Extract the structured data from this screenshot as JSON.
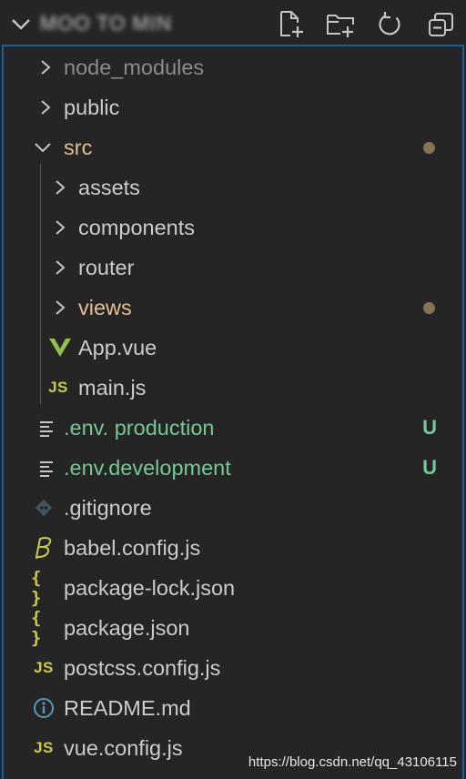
{
  "header": {
    "project_name": "MOO TO MIN",
    "actions": [
      "new-file-icon",
      "new-folder-icon",
      "refresh-icon",
      "collapse-all-icon"
    ]
  },
  "tree": {
    "items": [
      {
        "label": "node_modules",
        "kind": "folder",
        "expanded": false,
        "depth": 0,
        "status": "ignored"
      },
      {
        "label": "public",
        "kind": "folder",
        "expanded": false,
        "depth": 0
      },
      {
        "label": "src",
        "kind": "folder",
        "expanded": true,
        "depth": 0,
        "status": "modified"
      },
      {
        "label": "assets",
        "kind": "folder",
        "expanded": false,
        "depth": 1
      },
      {
        "label": "components",
        "kind": "folder",
        "expanded": false,
        "depth": 1
      },
      {
        "label": "router",
        "kind": "folder",
        "expanded": false,
        "depth": 1
      },
      {
        "label": "views",
        "kind": "folder",
        "expanded": false,
        "depth": 1,
        "status": "modified"
      },
      {
        "label": "App.vue",
        "kind": "file",
        "icon": "vue-icon",
        "depth": 1
      },
      {
        "label": "main.js",
        "kind": "file",
        "icon": "js-icon",
        "icon_text": "JS",
        "depth": 1
      },
      {
        "label": ".env. production",
        "kind": "file",
        "icon": "lines-icon",
        "depth": 0,
        "status": "untracked",
        "badge": "U"
      },
      {
        "label": ".env.development",
        "kind": "file",
        "icon": "lines-icon",
        "depth": 0,
        "status": "untracked",
        "badge": "U"
      },
      {
        "label": ".gitignore",
        "kind": "file",
        "icon": "git-icon",
        "depth": 0
      },
      {
        "label": "babel.config.js",
        "kind": "file",
        "icon": "babel-icon",
        "depth": 0
      },
      {
        "label": "package-lock.json",
        "kind": "file",
        "icon": "json-icon",
        "icon_text": "{ }",
        "depth": 0
      },
      {
        "label": "package.json",
        "kind": "file",
        "icon": "json-icon",
        "icon_text": "{ }",
        "depth": 0
      },
      {
        "label": "postcss.config.js",
        "kind": "file",
        "icon": "js-icon",
        "icon_text": "JS",
        "depth": 0
      },
      {
        "label": "README.md",
        "kind": "file",
        "icon": "info-icon",
        "depth": 0
      },
      {
        "label": "vue.config.js",
        "kind": "file",
        "icon": "js-icon",
        "icon_text": "JS",
        "depth": 0
      }
    ]
  },
  "colors": {
    "background": "#252526",
    "focus_border": "#0e639c",
    "modified": "#e2c08d",
    "modified_dot": "#8a7355",
    "untracked": "#73c991",
    "ignored": "#8c8c8c",
    "js_yellow": "#cbcb41",
    "vue_green": "#8dc149",
    "info_blue": "#519aba"
  },
  "watermark": "https://blog.csdn.net/qq_43106115"
}
